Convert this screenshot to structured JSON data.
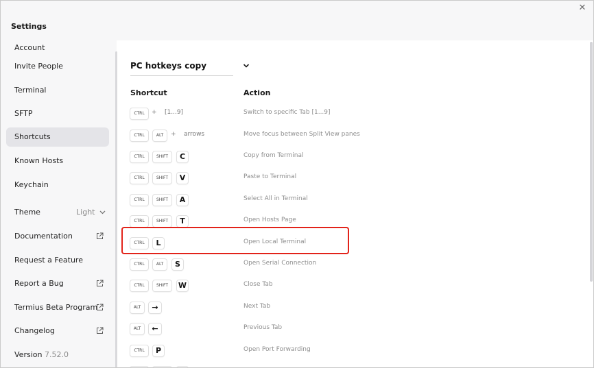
{
  "window": {
    "title": "Settings",
    "close_glyph": "✕",
    "highlight_color": "#e2231a"
  },
  "sidebar": {
    "items": [
      {
        "label": "Account"
      },
      {
        "label": "Invite People"
      },
      {
        "label": "Terminal"
      },
      {
        "label": "SFTP"
      },
      {
        "label": "Shortcuts",
        "active": true
      },
      {
        "label": "Known Hosts"
      },
      {
        "label": "Keychain"
      }
    ],
    "theme": {
      "label": "Theme",
      "value": "Light"
    },
    "links": [
      {
        "label": "Documentation",
        "icon": "external-link-icon"
      },
      {
        "label": "Request a Feature"
      },
      {
        "label": "Report a Bug",
        "icon": "external-link-icon"
      },
      {
        "label": "Termius Beta Program",
        "icon": "external-link-icon"
      },
      {
        "label": "Changelog",
        "icon": "external-link-icon"
      }
    ],
    "version": {
      "label": "Version",
      "value": "7.52.0"
    }
  },
  "shortcuts": {
    "preset": "PC hotkeys copy",
    "col_shortcut": "Shortcut",
    "col_action": "Action",
    "rows": [
      {
        "mod1": "CTRL",
        "plus": "+",
        "extra": "[1...9]",
        "action": "Switch to specific Tab [1...9]"
      },
      {
        "mod1": "CTRL",
        "mod2": "ALT",
        "plus": "+",
        "extra": "arrows",
        "action": "Move focus between Split View panes"
      },
      {
        "mod1": "CTRL",
        "mod2": "SHIFT",
        "key": "C",
        "action": "Copy from Terminal"
      },
      {
        "mod1": "CTRL",
        "mod2": "SHIFT",
        "key": "V",
        "action": "Paste to Terminal"
      },
      {
        "mod1": "CTRL",
        "mod2": "SHIFT",
        "key": "A",
        "action": "Select All in Terminal"
      },
      {
        "mod1": "CTRL",
        "mod2": "SHIFT",
        "key": "T",
        "action": "Open Hosts Page"
      },
      {
        "mod1": "CTRL",
        "key": "L",
        "action": "Open Local Terminal"
      },
      {
        "mod1": "CTRL",
        "mod2": "ALT",
        "key": "S",
        "action": "Open Serial Connection"
      },
      {
        "mod1": "CTRL",
        "mod2": "SHIFT",
        "key": "W",
        "action": "Close Tab"
      },
      {
        "mod1": "ALT",
        "key": "→",
        "action": "Next Tab"
      },
      {
        "mod1": "ALT",
        "key": "←",
        "action": "Previous Tab"
      },
      {
        "mod1": "CTRL",
        "key": "P",
        "action": "Open Port Forwarding"
      }
    ]
  }
}
